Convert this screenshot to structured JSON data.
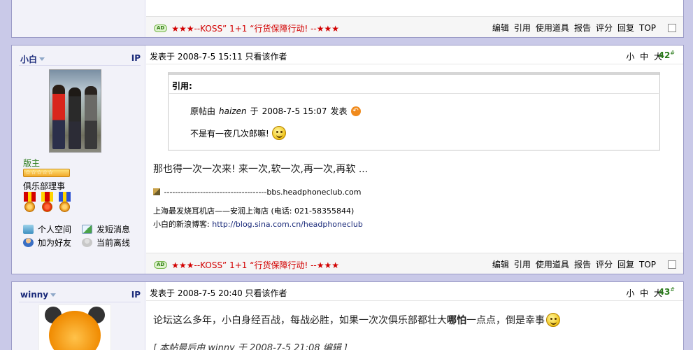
{
  "post_actions": [
    "编辑",
    "引用",
    "使用道具",
    "报告",
    "评分",
    "回复",
    "TOP"
  ],
  "ad": {
    "badge": "AD",
    "text": "★★★--KOSS” 1+1 “行货保障行动!  --★★★"
  },
  "posts": [
    {
      "author": "小白",
      "ip_label": "IP",
      "header": {
        "posted_prefix": "发表于",
        "datetime": "2008-7-5 15:11",
        "only_author": "只看该作者",
        "font_sizes": "小 中 大",
        "floor": "42",
        "floor_mark": "#"
      },
      "quote": {
        "title": "引用:",
        "line1_prefix": "原帖由",
        "line1_user": "haizen",
        "line1_mid": "于",
        "line1_time": "2008-7-5 15:07",
        "line1_suffix": "发表",
        "line2": "不是有一夜几次郎嘛!"
      },
      "body": "那也得一次一次来! 来一次,软一次,再一次,再软  ...",
      "signature": {
        "dash_link": "-------------------------------------bbs.headphoneclub.com",
        "line1": "上海最发烧耳机店——安润上海店  (电话: 021-58355844)",
        "line2_label": "小白的新浪博客:",
        "line2_url": "http://blog.sina.com.cn/headphoneclub"
      },
      "profile": {
        "role": "版主",
        "stars": "☆☆☆☆☆",
        "title": "俱乐部理事",
        "links": {
          "space": "个人空间",
          "message": "发短消息",
          "add_friend": "加为好友",
          "status": "当前离线"
        }
      }
    },
    {
      "author": "winny",
      "ip_label": "IP",
      "header": {
        "posted_prefix": "发表于",
        "datetime": "2008-7-5 20:40",
        "only_author": "只看该作者",
        "font_sizes": "小 中 大",
        "floor": "43",
        "floor_mark": "#"
      },
      "body_before": "论坛这么多年，小白身经百战，每战必胜，如果一次次俱乐部都壮大",
      "body_bold": "哪怕",
      "body_after": "一点点，倒是幸事",
      "edit_note": "[ 本帖最后由 winny 于 2008-7-5 21:08 编辑 ]"
    }
  ],
  "colors": {
    "background": "#c9c9e8",
    "ad_red": "#d20000",
    "role_green": "#2a7b1b",
    "name_blue": "#1a2a7a"
  }
}
